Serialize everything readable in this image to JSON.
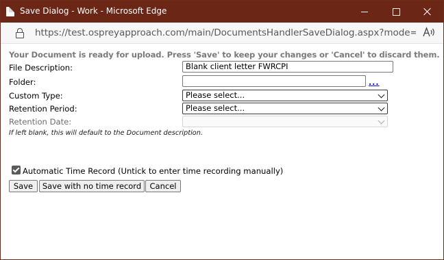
{
  "window": {
    "title": "Save Dialog - Work - Microsoft Edge",
    "title_bar_color": "#6b2616"
  },
  "address_bar": {
    "url": "https://test.ospreyapproach.com/main/DocumentsHandlerSaveDialog.aspx?mode=2&d...",
    "read_aloud_glyph": "A))"
  },
  "form": {
    "message": "Your Document is ready for upload. Press 'Save' to keep your changes or 'Cancel' to discard them.",
    "file_description": {
      "label": "File Description:",
      "value": "Blank client letter FWRCPI"
    },
    "folder": {
      "label": "Folder:",
      "value": "",
      "browse_link": "..."
    },
    "custom_type": {
      "label": "Custom Type:",
      "selected": "Please select..."
    },
    "retention_period": {
      "label": "Retention Period:",
      "selected": "Please select..."
    },
    "retention_date": {
      "label": "Retention Date:",
      "selected": "",
      "disabled": true
    },
    "hint": "If left blank, this will default to the Document description.",
    "auto_time_record": {
      "label": "Automatic Time Record (Untick to enter time recording manually)",
      "checked": true
    }
  },
  "buttons": {
    "save": "Save",
    "save_no_time": "Save with no time record",
    "cancel": "Cancel"
  }
}
